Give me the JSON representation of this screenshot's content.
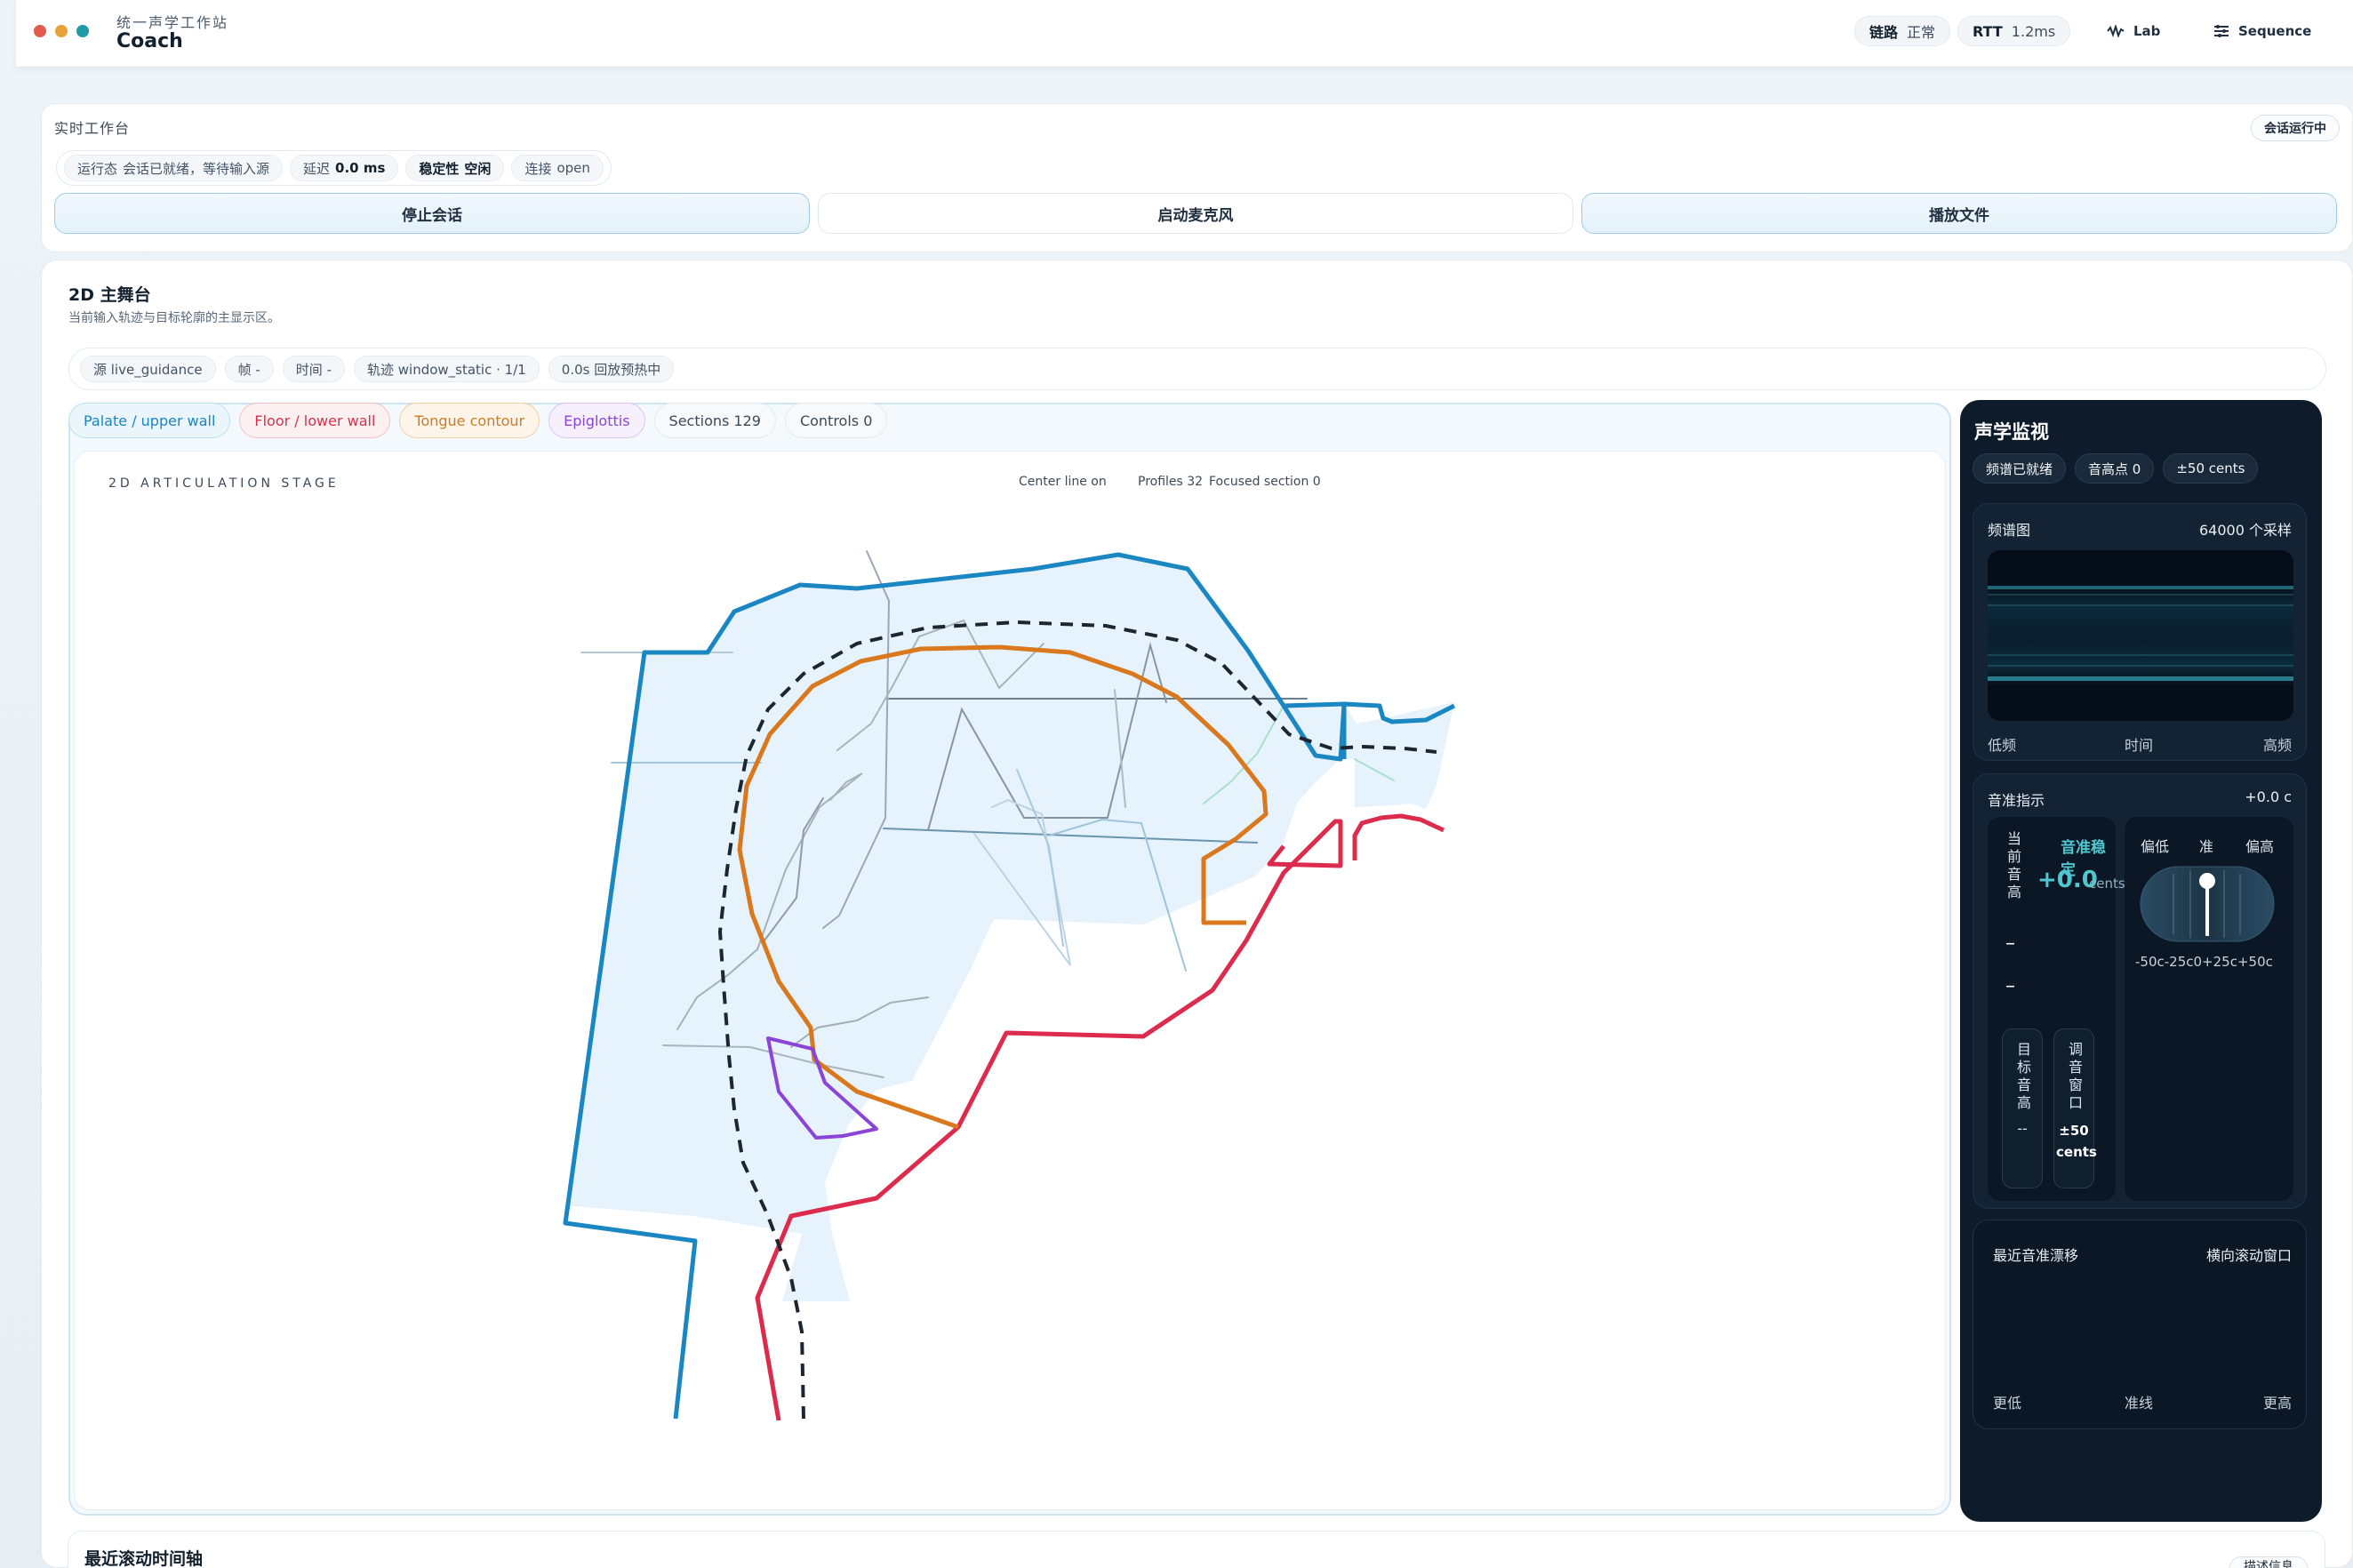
{
  "topbar": {
    "brand_sub": "统一声学工作站",
    "brand_title": "Coach",
    "link_label": "链路",
    "link_value": "正常",
    "rtt_label": "RTT",
    "rtt_value": "1.2ms",
    "nav_lab": "Lab",
    "nav_sequence": "Sequence",
    "window_dots": [
      "#e25c4b",
      "#e8a23a",
      "#1f9aa6"
    ]
  },
  "workbench": {
    "title": "实时工作台",
    "badge": "会话运行中",
    "status": {
      "state_label": "运行态",
      "state_value": "会话已就绪，等待输入源",
      "latency_label": "延迟",
      "latency_value": "0.0 ms",
      "stability_label": "稳定性",
      "stability_value": "空闲",
      "connection_label": "连接",
      "connection_value": "open"
    },
    "buttons": {
      "stop": "停止会话",
      "mic": "启动麦克风",
      "play": "播放文件"
    }
  },
  "stage": {
    "title": "2D 主舞台",
    "subtitle": "当前输入轨迹与目标轮廓的主显示区。",
    "filters": {
      "source": "源 live_guidance",
      "frame": "帧 -",
      "time": "时间 -",
      "track": "轨迹 window_static · 1/1",
      "replay": "0.0s 回放预热中"
    },
    "legend": {
      "palate": "Palate / upper wall",
      "floor": "Floor / lower wall",
      "tongue": "Tongue contour",
      "epiglottis": "Epiglottis",
      "sections": "Sections 129",
      "controls": "Controls 0"
    },
    "canvas_label": "2D ARTICULATION STAGE",
    "meta": {
      "centerline": "Center line on",
      "profiles": "Profiles 32",
      "focused": "Focused section 0"
    },
    "colors": {
      "palate": "#1a86c2",
      "floor": "#dc2b4c",
      "tongue": "#d9781c",
      "epiglottis": "#8a45d6",
      "centerline": "#1d2630",
      "fill": "#e2f0fb"
    }
  },
  "monitor": {
    "title": "声学监视",
    "chips": {
      "spectrum": "频谱已就绪",
      "pitch_points": "音高点 0",
      "window": "±50 cents"
    },
    "spectrogram": {
      "label": "频谱图",
      "samples": "64000 个采样",
      "low": "低频",
      "time": "时间",
      "high": "高频"
    },
    "pitch": {
      "label": "音准指示",
      "offset": "+0.0 c",
      "current_label": "当前音高",
      "dash1": "–",
      "dash2": "–",
      "stable": "音准稳定",
      "cents_value": "+0.0",
      "cents_unit": "cents",
      "target_label": "目标音高",
      "target_value": "--",
      "window_label": "调音窗口",
      "window_value": "±50 cents",
      "low": "偏低",
      "ok": "准",
      "high": "偏高",
      "scale": [
        "-50c",
        "-25c",
        "0",
        "+25c",
        "+50c"
      ]
    },
    "drift": {
      "label": "最近音准漂移",
      "mode": "横向滚动窗口",
      "lower": "更低",
      "baseline": "准线",
      "higher": "更高"
    }
  },
  "timeline": {
    "title": "最近滚动时间轴",
    "button": "描述信息"
  }
}
